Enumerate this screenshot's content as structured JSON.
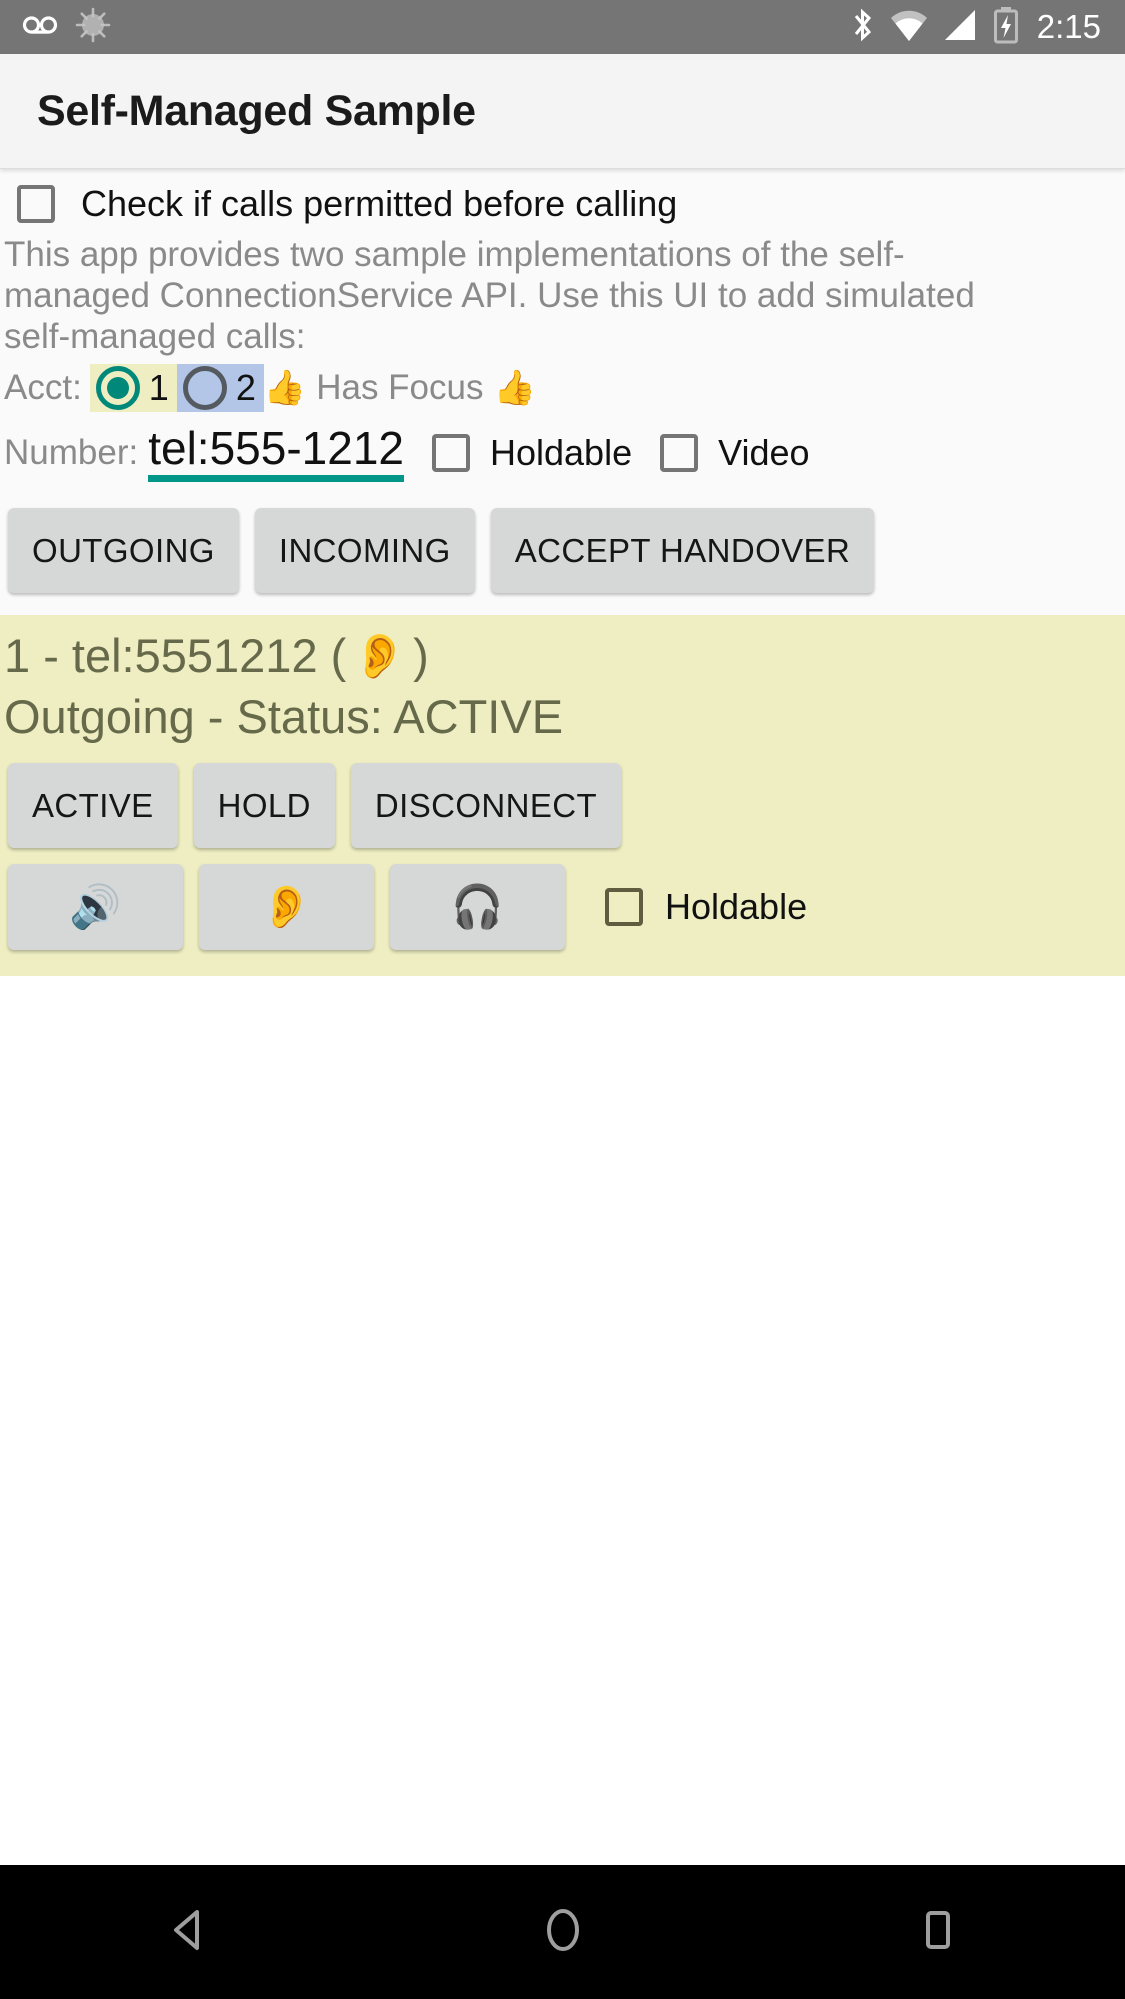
{
  "status_bar": {
    "icons": [
      "voicemail-icon",
      "sync-spinner-icon"
    ],
    "right_icons": [
      "bluetooth-icon",
      "wifi-icon",
      "cell-signal-icon",
      "battery-charging-icon"
    ],
    "clock": "2:15",
    "background": "#757575"
  },
  "app_bar": {
    "title": "Self-Managed Sample",
    "background": "#f4f4f4"
  },
  "permit": {
    "label": "Check if calls permitted before calling",
    "checked": false
  },
  "description": "This app provides two sample implementations of the self-managed ConnectionService API.  Use this UI to add simulated self-managed calls:",
  "account": {
    "label": "Acct:",
    "options": [
      {
        "value": "1",
        "selected": true,
        "chip_bg": "#eeeec2",
        "radio_color": "#00897b"
      },
      {
        "value": "2",
        "selected": false,
        "chip_bg": "#b3c6e7",
        "radio_color": "#555a60"
      }
    ],
    "focus_left_icon": "thumbs-up-icon",
    "focus_text": "Has Focus",
    "focus_right_icon": "thumbs-up-icon",
    "focus_emoji": "👍"
  },
  "number": {
    "label": "Number:",
    "value": "tel:555-1212",
    "underline_color": "#009688",
    "holdable_label": "Holdable",
    "holdable_checked": false,
    "video_label": "Video",
    "video_checked": false
  },
  "actions": [
    {
      "label": "OUTGOING",
      "name": "outgoing-button"
    },
    {
      "label": "INCOMING",
      "name": "incoming-button"
    },
    {
      "label": "ACCEPT HANDOVER",
      "name": "accept-handover-button"
    }
  ],
  "call": {
    "title_prefix": "1 - tel:5551212 (",
    "title_icon": "ear-icon",
    "title_emoji": "👂",
    "title_suffix": ")",
    "status_line": "Outgoing - Status: ACTIVE",
    "background": "#eeeec2",
    "text_color": "#666a4a",
    "state_buttons": [
      {
        "label": "ACTIVE",
        "name": "call-active-button"
      },
      {
        "label": "HOLD",
        "name": "call-hold-button"
      },
      {
        "label": "DISCONNECT",
        "name": "call-disconnect-button"
      }
    ],
    "audio_buttons": [
      {
        "icon": "speaker-icon",
        "emoji": "🔊",
        "name": "audio-route-speaker-button"
      },
      {
        "icon": "earpiece-icon",
        "emoji": "👂",
        "name": "audio-route-earpiece-button"
      },
      {
        "icon": "headset-icon",
        "emoji": "🎧",
        "name": "audio-route-headset-button"
      }
    ],
    "holdable_label": "Holdable",
    "holdable_checked": false
  },
  "nav_bar": {
    "background": "#000000",
    "items": [
      {
        "name": "nav-back-button",
        "icon": "back-triangle-icon"
      },
      {
        "name": "nav-home-button",
        "icon": "home-circle-icon"
      },
      {
        "name": "nav-recents-button",
        "icon": "recents-square-icon"
      }
    ]
  }
}
